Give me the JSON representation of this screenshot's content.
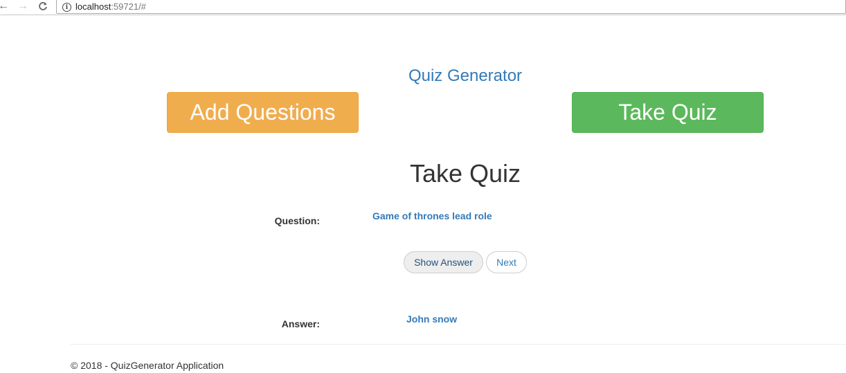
{
  "browser": {
    "back_icon": "arrow-left-icon",
    "forward_icon": "arrow-right-icon",
    "reload_icon": "reload-icon",
    "url_host": "localhost",
    "url_rest": ":59721/#"
  },
  "header": {
    "app_title": "Quiz Generator",
    "add_questions_label": "Add Questions",
    "take_quiz_label": "Take Quiz"
  },
  "main": {
    "section_title": "Take Quiz",
    "question_label": "Question:",
    "question_text": "Game of thrones lead role",
    "show_answer_label": "Show Answer",
    "next_label": "Next",
    "answer_label": "Answer:",
    "answer_text": "John snow"
  },
  "footer": {
    "text": "© 2018 - QuizGenerator Application"
  },
  "colors": {
    "brand_link": "#337ab7",
    "warning": "#f0ad4e",
    "success": "#5cb85c"
  }
}
